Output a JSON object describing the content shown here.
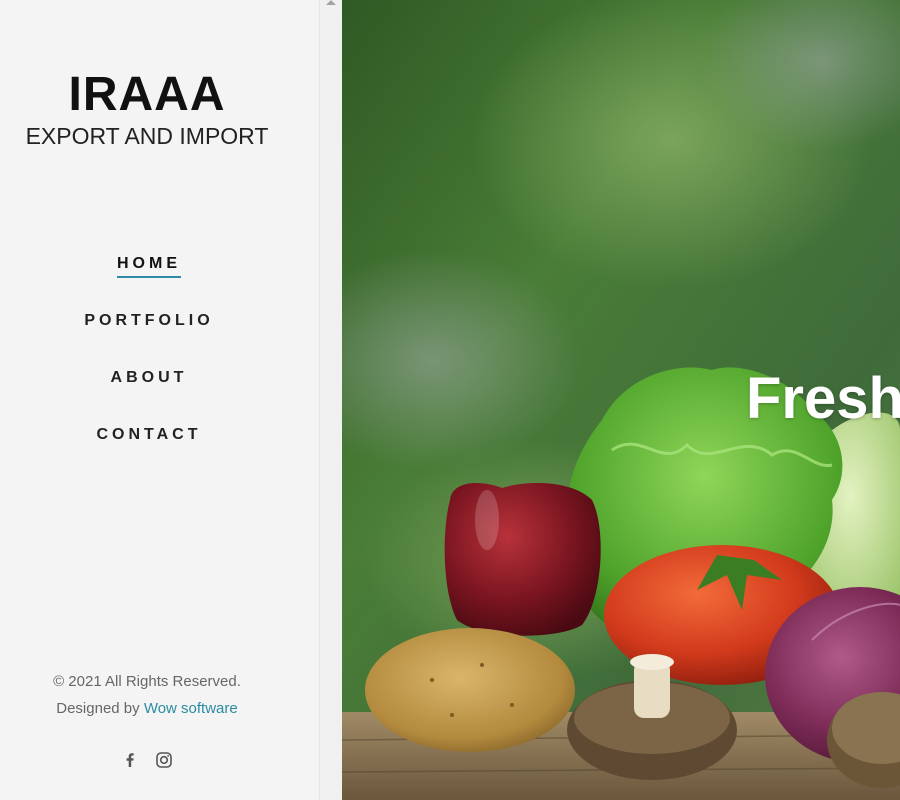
{
  "brand": {
    "name": "IRAAA",
    "tagline": "EXPORT AND IMPORT"
  },
  "nav": {
    "items": [
      {
        "label": "HOME",
        "active": true
      },
      {
        "label": "PORTFOLIO",
        "active": false
      },
      {
        "label": "ABOUT",
        "active": false
      },
      {
        "label": "CONTACT",
        "active": false
      }
    ]
  },
  "footer": {
    "copyright": "© 2021 All Rights Reserved.",
    "designed_by_prefix": "Designed by",
    "designer_link": "Wow software"
  },
  "social": {
    "icons": [
      "facebook-icon",
      "instagram-icon"
    ]
  },
  "hero": {
    "title": "Fresh"
  },
  "colors": {
    "sidebar_bg": "#f4f4f4",
    "accent": "#2f8aa6",
    "link": "#2a8ca2",
    "hero_green": "#3b6a2c"
  }
}
